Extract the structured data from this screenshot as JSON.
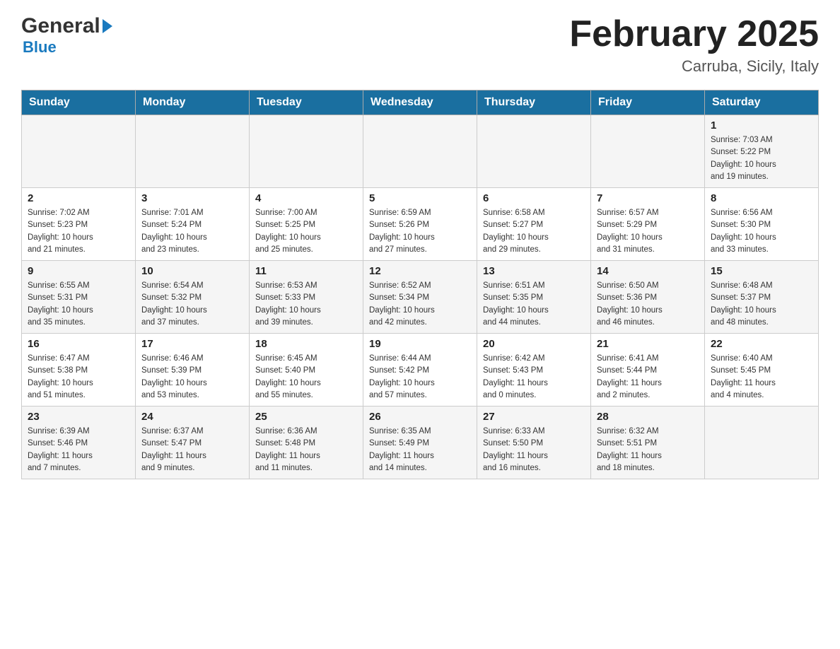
{
  "header": {
    "logo_general": "General",
    "logo_blue": "Blue",
    "title": "February 2025",
    "subtitle": "Carruba, Sicily, Italy"
  },
  "calendar": {
    "days_of_week": [
      "Sunday",
      "Monday",
      "Tuesday",
      "Wednesday",
      "Thursday",
      "Friday",
      "Saturday"
    ],
    "weeks": [
      [
        {
          "day": "",
          "info": "",
          "empty": true
        },
        {
          "day": "",
          "info": "",
          "empty": true
        },
        {
          "day": "",
          "info": "",
          "empty": true
        },
        {
          "day": "",
          "info": "",
          "empty": true
        },
        {
          "day": "",
          "info": "",
          "empty": true
        },
        {
          "day": "",
          "info": "",
          "empty": true
        },
        {
          "day": "1",
          "info": "Sunrise: 7:03 AM\nSunset: 5:22 PM\nDaylight: 10 hours\nand 19 minutes.",
          "empty": false
        }
      ],
      [
        {
          "day": "2",
          "info": "Sunrise: 7:02 AM\nSunset: 5:23 PM\nDaylight: 10 hours\nand 21 minutes.",
          "empty": false
        },
        {
          "day": "3",
          "info": "Sunrise: 7:01 AM\nSunset: 5:24 PM\nDaylight: 10 hours\nand 23 minutes.",
          "empty": false
        },
        {
          "day": "4",
          "info": "Sunrise: 7:00 AM\nSunset: 5:25 PM\nDaylight: 10 hours\nand 25 minutes.",
          "empty": false
        },
        {
          "day": "5",
          "info": "Sunrise: 6:59 AM\nSunset: 5:26 PM\nDaylight: 10 hours\nand 27 minutes.",
          "empty": false
        },
        {
          "day": "6",
          "info": "Sunrise: 6:58 AM\nSunset: 5:27 PM\nDaylight: 10 hours\nand 29 minutes.",
          "empty": false
        },
        {
          "day": "7",
          "info": "Sunrise: 6:57 AM\nSunset: 5:29 PM\nDaylight: 10 hours\nand 31 minutes.",
          "empty": false
        },
        {
          "day": "8",
          "info": "Sunrise: 6:56 AM\nSunset: 5:30 PM\nDaylight: 10 hours\nand 33 minutes.",
          "empty": false
        }
      ],
      [
        {
          "day": "9",
          "info": "Sunrise: 6:55 AM\nSunset: 5:31 PM\nDaylight: 10 hours\nand 35 minutes.",
          "empty": false
        },
        {
          "day": "10",
          "info": "Sunrise: 6:54 AM\nSunset: 5:32 PM\nDaylight: 10 hours\nand 37 minutes.",
          "empty": false
        },
        {
          "day": "11",
          "info": "Sunrise: 6:53 AM\nSunset: 5:33 PM\nDaylight: 10 hours\nand 39 minutes.",
          "empty": false
        },
        {
          "day": "12",
          "info": "Sunrise: 6:52 AM\nSunset: 5:34 PM\nDaylight: 10 hours\nand 42 minutes.",
          "empty": false
        },
        {
          "day": "13",
          "info": "Sunrise: 6:51 AM\nSunset: 5:35 PM\nDaylight: 10 hours\nand 44 minutes.",
          "empty": false
        },
        {
          "day": "14",
          "info": "Sunrise: 6:50 AM\nSunset: 5:36 PM\nDaylight: 10 hours\nand 46 minutes.",
          "empty": false
        },
        {
          "day": "15",
          "info": "Sunrise: 6:48 AM\nSunset: 5:37 PM\nDaylight: 10 hours\nand 48 minutes.",
          "empty": false
        }
      ],
      [
        {
          "day": "16",
          "info": "Sunrise: 6:47 AM\nSunset: 5:38 PM\nDaylight: 10 hours\nand 51 minutes.",
          "empty": false
        },
        {
          "day": "17",
          "info": "Sunrise: 6:46 AM\nSunset: 5:39 PM\nDaylight: 10 hours\nand 53 minutes.",
          "empty": false
        },
        {
          "day": "18",
          "info": "Sunrise: 6:45 AM\nSunset: 5:40 PM\nDaylight: 10 hours\nand 55 minutes.",
          "empty": false
        },
        {
          "day": "19",
          "info": "Sunrise: 6:44 AM\nSunset: 5:42 PM\nDaylight: 10 hours\nand 57 minutes.",
          "empty": false
        },
        {
          "day": "20",
          "info": "Sunrise: 6:42 AM\nSunset: 5:43 PM\nDaylight: 11 hours\nand 0 minutes.",
          "empty": false
        },
        {
          "day": "21",
          "info": "Sunrise: 6:41 AM\nSunset: 5:44 PM\nDaylight: 11 hours\nand 2 minutes.",
          "empty": false
        },
        {
          "day": "22",
          "info": "Sunrise: 6:40 AM\nSunset: 5:45 PM\nDaylight: 11 hours\nand 4 minutes.",
          "empty": false
        }
      ],
      [
        {
          "day": "23",
          "info": "Sunrise: 6:39 AM\nSunset: 5:46 PM\nDaylight: 11 hours\nand 7 minutes.",
          "empty": false
        },
        {
          "day": "24",
          "info": "Sunrise: 6:37 AM\nSunset: 5:47 PM\nDaylight: 11 hours\nand 9 minutes.",
          "empty": false
        },
        {
          "day": "25",
          "info": "Sunrise: 6:36 AM\nSunset: 5:48 PM\nDaylight: 11 hours\nand 11 minutes.",
          "empty": false
        },
        {
          "day": "26",
          "info": "Sunrise: 6:35 AM\nSunset: 5:49 PM\nDaylight: 11 hours\nand 14 minutes.",
          "empty": false
        },
        {
          "day": "27",
          "info": "Sunrise: 6:33 AM\nSunset: 5:50 PM\nDaylight: 11 hours\nand 16 minutes.",
          "empty": false
        },
        {
          "day": "28",
          "info": "Sunrise: 6:32 AM\nSunset: 5:51 PM\nDaylight: 11 hours\nand 18 minutes.",
          "empty": false
        },
        {
          "day": "",
          "info": "",
          "empty": true
        }
      ]
    ]
  }
}
